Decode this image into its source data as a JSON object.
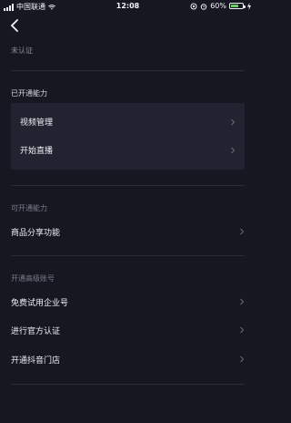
{
  "status_bar": {
    "carrier": "中国联通",
    "time": "12:08",
    "battery_text": "60%"
  },
  "top_section": {
    "status_label": "未认证"
  },
  "enabled_section": {
    "title": "已开通能力",
    "items": [
      {
        "label": "视频管理"
      },
      {
        "label": "开始直播"
      }
    ]
  },
  "available_section": {
    "title": "可开通能力",
    "items": [
      {
        "label": "商品分享功能"
      }
    ]
  },
  "advanced_section": {
    "title": "开通高级账号",
    "items": [
      {
        "label": "免费试用企业号"
      },
      {
        "label": "进行官方认证"
      },
      {
        "label": "开通抖音门店"
      }
    ]
  },
  "colors": {
    "background": "#161721",
    "card": "#222330",
    "divider": "#2a2b36",
    "text_primary": "#f0f0f5",
    "text_secondary": "#8a8b97",
    "chevron": "#6b6c78"
  },
  "icons": {
    "back": "back-arrow-icon",
    "chevron": "chevron-right-icon"
  }
}
